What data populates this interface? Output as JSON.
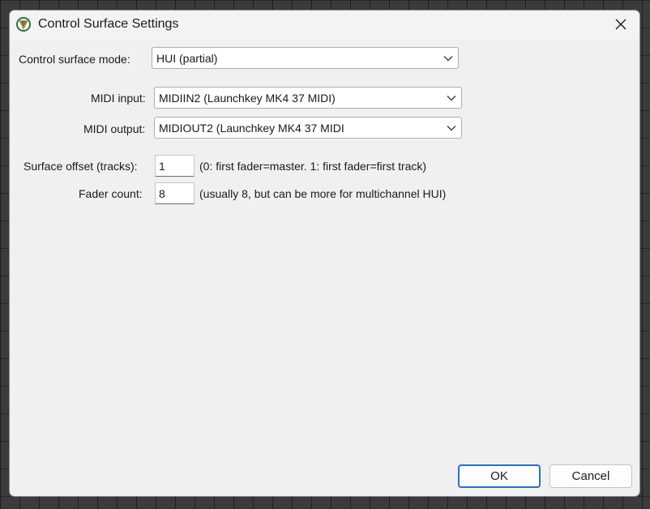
{
  "window": {
    "title": "Control Surface Settings",
    "close_glyph": "✕"
  },
  "form": {
    "mode_label": "Control surface mode:",
    "mode_value": "HUI (partial)",
    "midi_input_label": "MIDI input:",
    "midi_input_value": "MIDIIN2 (Launchkey MK4 37 MIDI)",
    "midi_output_label": "MIDI output:",
    "midi_output_value": "MIDIOUT2 (Launchkey MK4 37 MIDI",
    "offset_label": "Surface offset (tracks):",
    "offset_value": "1",
    "offset_hint": "(0: first fader=master. 1: first fader=first track)",
    "fader_label": "Fader count:",
    "fader_value": "8",
    "fader_hint": "(usually 8, but can be more for multichannel HUI)"
  },
  "buttons": {
    "ok": "OK",
    "cancel": "Cancel"
  },
  "icons": {
    "app": "reaper-app-icon",
    "close": "close-icon",
    "dropdown": "chevron-down-icon"
  },
  "colors": {
    "dialog_bg": "#f0f0f0",
    "default_button_border": "#2d6fbf",
    "app_icon_green": "#3a8f5c",
    "app_icon_orange": "#e0803a"
  }
}
